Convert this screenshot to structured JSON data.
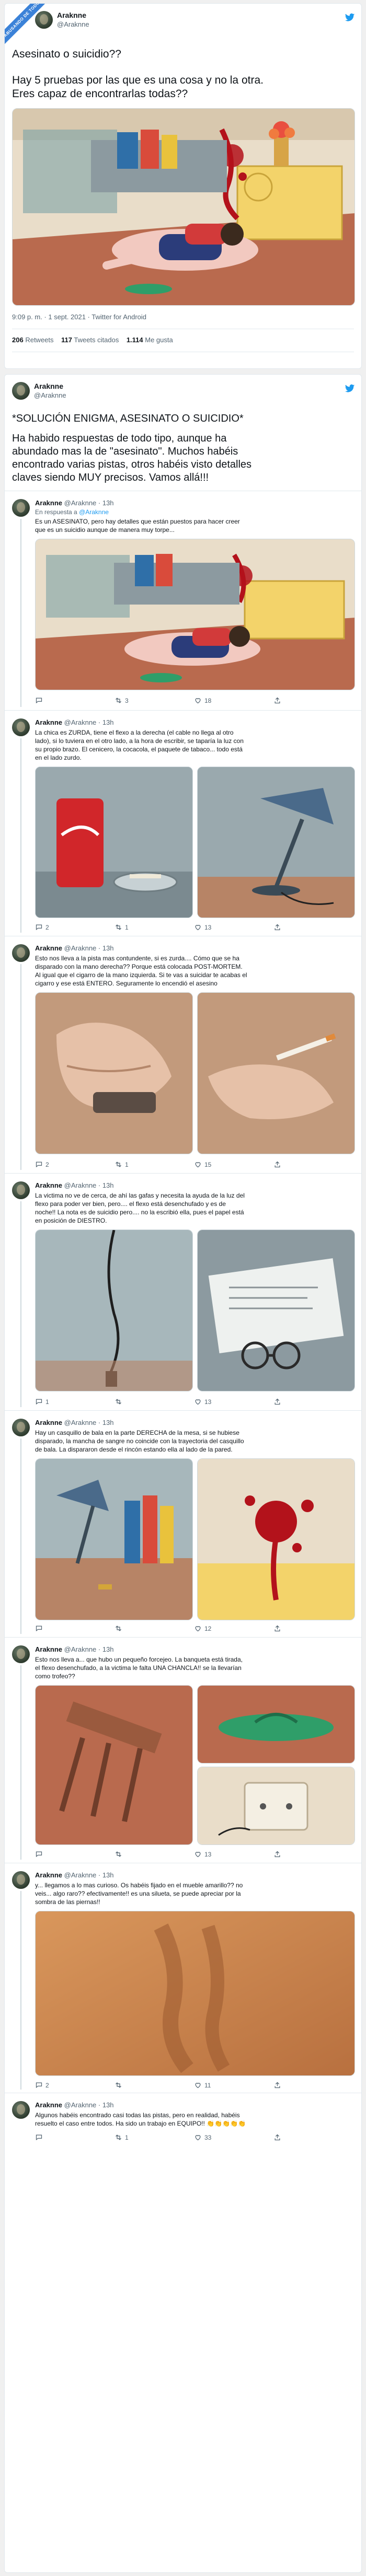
{
  "banner": {
    "text": "ABUSANDO DE TODOS"
  },
  "author": {
    "name": "Araknne",
    "handle": "@Araknne"
  },
  "tweet1": {
    "text_line1": "Asesinato o suicidio??",
    "text_line2": "Hay 5 pruebas por las que es una cosa y no la otra.",
    "text_line3": "Eres capaz de encontrarlas todas??",
    "timestamp": "9:09 p. m. · 1 sept. 2021 · Twitter for Android",
    "retweets_count": "206",
    "retweets_label": "Retweets",
    "quotes_count": "117",
    "quotes_label": "Tweets citados",
    "likes_count": "1.114",
    "likes_label": "Me gusta"
  },
  "tweet2": {
    "line1": "*SOLUCIÓN ENIGMA, ASESINATO O SUICIDIO*",
    "line2": "Ha habido respuestas de todo tipo, aunque ha",
    "line3": "abundado mas la de \"asesinato\". Muchos habéis",
    "line4": "encontrado varias pistas, otros habéis visto detalles",
    "line5": "claves siendo MUY precisos. Vamos allá!!!"
  },
  "replies": [
    {
      "time": "· 13h",
      "in_reply_prefix": "En respuesta a",
      "in_reply_handle": "@Araknne",
      "lines": [
        "Es un ASESINATO, pero hay detalles que están puestos para hacer creer",
        "que es un suicidio aunque de manera muy torpe..."
      ],
      "reply": "",
      "retweet": "3",
      "like": "18"
    },
    {
      "time": "· 13h",
      "lines": [
        "La chica es ZURDA, tiene el flexo a la derecha (el cable no llega al otro",
        "lado), si lo tuviera en el otro lado, a la hora de escribir, se taparía la luz con",
        "su propio brazo. El  cenicero, la cocacola, el paquete de tabaco... todo está",
        "en el lado zurdo."
      ],
      "reply": "2",
      "retweet": "1",
      "like": "13"
    },
    {
      "time": "· 13h",
      "lines": [
        "Esto nos lleva a la pista mas contundente, si es zurda.... Cómo que se ha",
        "disparado con la mano derecha?? Porque está colocada POST-MORTEM.",
        "Al igual que el cigarro de la mano izquierda. Si te vas a suicidar te acabas el",
        "cigarro y ese está ENTERO. Seguramente lo encendió el asesino"
      ],
      "reply": "2",
      "retweet": "1",
      "like": "15"
    },
    {
      "time": "· 13h",
      "lines": [
        "La victima no ve de cerca, de ahí las gafas y necesita la ayuda de la luz del",
        "flexo para poder ver bien, pero.... el flexo está desenchufado y es de",
        "noche!! La nota es de suicidio pero.... no la escribió ella, pues el papel está",
        "en posición de DIESTRO."
      ],
      "reply": "1",
      "retweet": "",
      "like": "13"
    },
    {
      "time": "· 13h",
      "lines": [
        "Hay un casquillo de bala en la parte DERECHA de la mesa, si se hubiese",
        "disparado, la mancha de sangre no coincide con la trayectoria del casquillo",
        "de bala. La dispararon desde el rincón estando ella al lado de la pared."
      ],
      "reply": "",
      "retweet": "",
      "like": "12"
    },
    {
      "time": "· 13h",
      "lines": [
        "Esto nos lleva a... que hubo un pequeño forcejeo. La banqueta está tirada,",
        "el flexo desenchufado, a la victima le falta UNA CHANCLA!! se la llevarían",
        "como trofeo??"
      ],
      "reply": "",
      "retweet": "",
      "like": "13"
    },
    {
      "time": "· 13h",
      "lines": [
        "y... llegamos a lo mas curioso. Os habéis fijado en el mueble amarillo?? no",
        "veis... algo raro?? efectivamente!! es una silueta, se puede apreciar por la",
        "sombra de las piernas!!"
      ],
      "reply": "2",
      "retweet": "",
      "like": "11"
    },
    {
      "time": "· 13h",
      "lines": [
        "Algunos habéis encontrado casi todas las pistas, pero en realidad, habéis",
        "resuelto el caso entre todos. Ha sido un trabajo en EQUIPO!! 👏👏👏👏👏"
      ],
      "reply": "",
      "retweet": "1",
      "like": "33"
    }
  ],
  "colors": {
    "accent": "#1d9bf0",
    "blood": "#b3121b",
    "floor": "#b96a4e",
    "wall": "#e9ddc9"
  }
}
